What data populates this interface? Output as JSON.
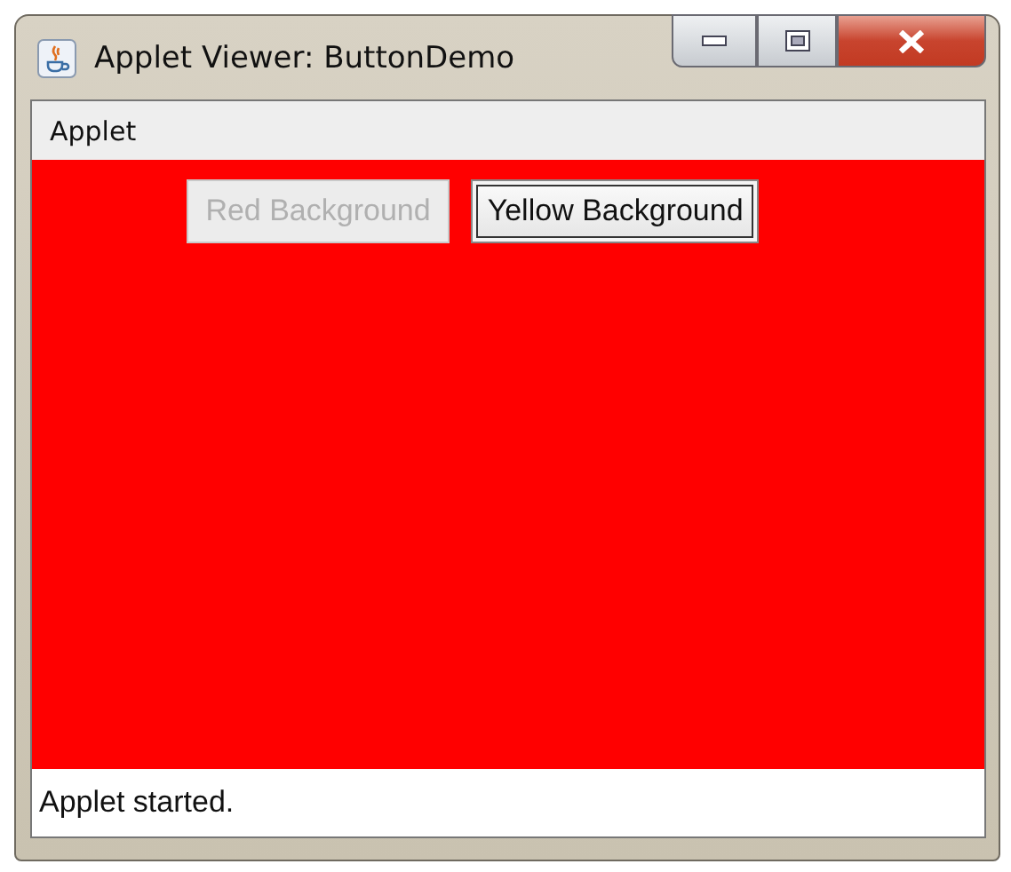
{
  "window": {
    "title": "Applet Viewer: ButtonDemo"
  },
  "menu_bar": {
    "items": [
      "Applet"
    ]
  },
  "applet": {
    "color": "#ff0000",
    "buttons": [
      {
        "label": "Red Background",
        "disabled": true,
        "focused": false
      },
      {
        "label": "Yellow Background",
        "disabled": false,
        "focused": true
      }
    ]
  },
  "status_bar": {
    "text": "Applet started."
  }
}
